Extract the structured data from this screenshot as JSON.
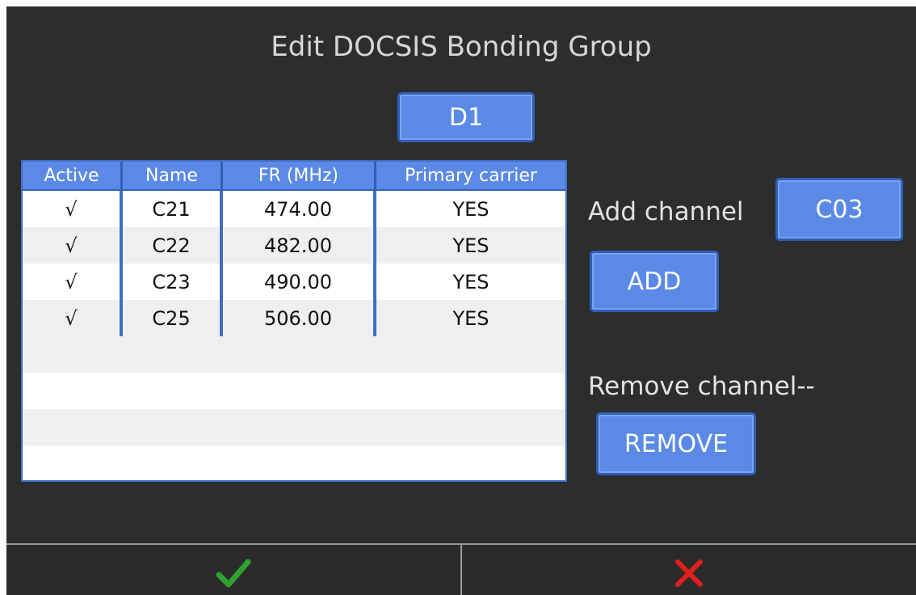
{
  "dialog": {
    "title": "Edit DOCSIS Bonding Group",
    "group_button": "D1"
  },
  "table": {
    "headers": [
      "Active",
      "Name",
      "FR (MHz)",
      "Primary carrier"
    ],
    "rows": [
      {
        "active": "√",
        "name": "C21",
        "freq": "474.00",
        "primary": "YES"
      },
      {
        "active": "√",
        "name": "C22",
        "freq": "482.00",
        "primary": "YES"
      },
      {
        "active": "√",
        "name": "C23",
        "freq": "490.00",
        "primary": "YES"
      },
      {
        "active": "√",
        "name": "C25",
        "freq": "506.00",
        "primary": "YES"
      }
    ]
  },
  "add": {
    "label": "Add channel",
    "channel_value": "C03",
    "button": "ADD"
  },
  "remove": {
    "label": "Remove channel--",
    "button": "REMOVE"
  },
  "footer": {
    "confirm_icon": "checkmark-icon",
    "cancel_icon": "x-icon",
    "confirm_color": "#2fa12f",
    "cancel_color": "#e0201e"
  },
  "colors": {
    "background": "#2d2d2d",
    "button": "#5b8ae6",
    "button_border": "#2f5fb8"
  }
}
